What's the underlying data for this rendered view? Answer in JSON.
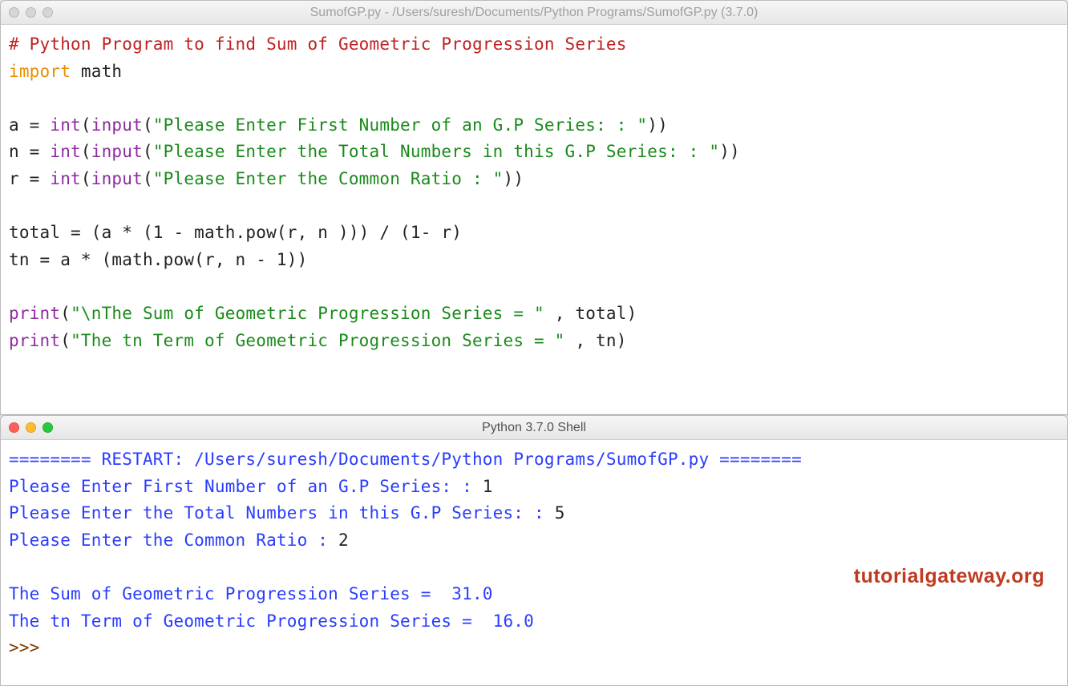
{
  "editor": {
    "title": "SumofGP.py - /Users/suresh/Documents/Python Programs/SumofGP.py (3.7.0)",
    "code": {
      "comment": "# Python Program to find Sum of Geometric Progression Series",
      "kw_import": "import",
      "module": " math",
      "var_a": "a = ",
      "var_n": "n = ",
      "var_r": "r = ",
      "fn_int": "int",
      "fn_input": "input",
      "open": "(",
      "close": ")",
      "dopen": "((",
      "dclose": "))",
      "str_a": "\"Please Enter First Number of an G.P Series: : \"",
      "str_n": "\"Please Enter the Total Numbers in this G.P Series: : \"",
      "str_r": "\"Please Enter the Common Ratio : \"",
      "total_line": "total = (a * (1 - math.pow(r, n ))) / (1- r)",
      "tn_line": "tn = a * (math.pow(r, n - 1))",
      "fn_print": "print",
      "str_sum": "\"\\nThe Sum of Geometric Progression Series = \" ",
      "sum_tail": ", total)",
      "str_tn": "\"The tn Term of Geometric Progression Series = \" ",
      "tn_tail": ", tn)"
    }
  },
  "shell": {
    "title": "Python 3.7.0 Shell",
    "restart_pre": "======== ",
    "restart": "RESTART: /Users/suresh/Documents/Python Programs/SumofGP.py",
    "restart_post": " ========",
    "p1": "Please Enter First Number of an G.P Series: : ",
    "v1": "1",
    "p2": "Please Enter the Total Numbers in this G.P Series: : ",
    "v2": "5",
    "p3": "Please Enter the Common Ratio : ",
    "v3": "2",
    "out1_a": "The Sum of Geometric Progression Series =  ",
    "out1_b": "31.0",
    "out2_a": "The tn Term of Geometric Progression Series =  ",
    "out2_b": "16.0",
    "prompt": ">>>"
  },
  "watermark": "tutorialgateway.org"
}
